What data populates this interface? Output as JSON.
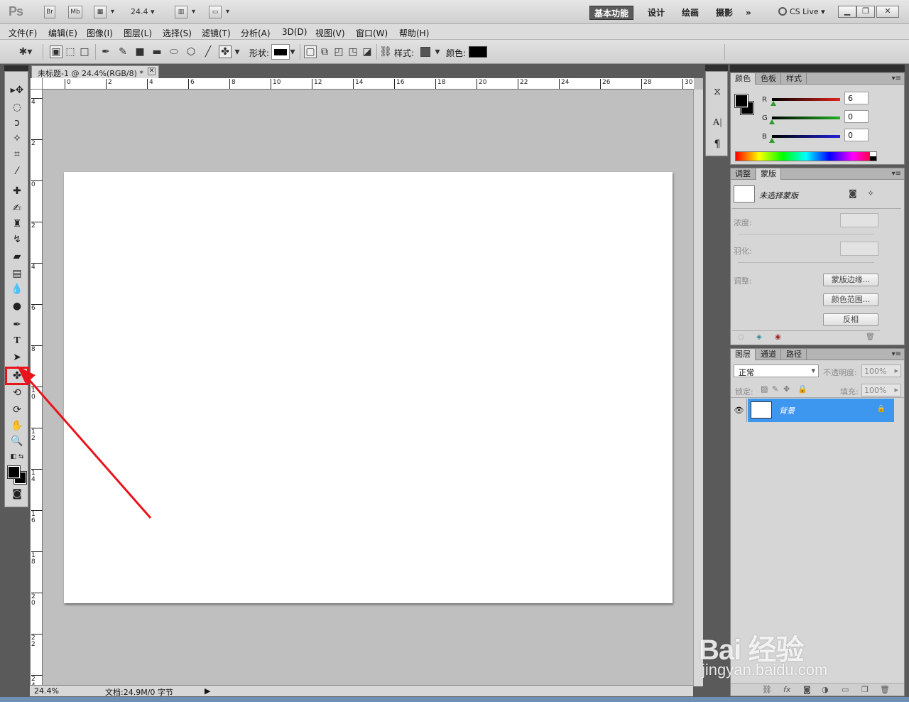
{
  "app": {
    "logo": "Ps",
    "bridge_label": "Br",
    "minibridge_label": "Mb",
    "zoom_value": "24.4",
    "workspaces": [
      "基本功能",
      "设计",
      "绘画",
      "摄影"
    ],
    "more_workspaces": "»",
    "cs_live": "CS Live"
  },
  "menu": [
    "文件(F)",
    "编辑(E)",
    "图像(I)",
    "图层(L)",
    "选择(S)",
    "滤镜(T)",
    "分析(A)",
    "3D(D)",
    "视图(V)",
    "窗口(W)",
    "帮助(H)"
  ],
  "options": {
    "shape_label": "形状:",
    "style_label": "样式:",
    "color_label": "颜色:",
    "color_value": "#000000"
  },
  "document": {
    "tab_title": "未标题-1 @ 24.4%(RGB/8) *",
    "ruler_top": [
      "0",
      "2",
      "4",
      "6",
      "8",
      "10",
      "12",
      "14",
      "16",
      "18",
      "20",
      "22",
      "24",
      "26",
      "28",
      "30"
    ],
    "ruler_left": [
      "4",
      "2",
      "0",
      "2",
      "4",
      "6",
      "8",
      "1 0",
      "1 2",
      "1 4",
      "1 6",
      "1 8",
      "2 0",
      "2 2",
      "2 4"
    ],
    "status_zoom": "24.4%",
    "status_doc": "文档:24.9M/0 字节"
  },
  "color_panel": {
    "tabs": [
      "颜色",
      "色板",
      "样式"
    ],
    "channels": [
      {
        "label": "R",
        "value": "6",
        "color": "#e0231b"
      },
      {
        "label": "G",
        "value": "0",
        "color": "#22b022"
      },
      {
        "label": "B",
        "value": "0",
        "color": "#2222d8"
      }
    ]
  },
  "masks_panel": {
    "tabs": [
      "调整",
      "蒙版"
    ],
    "no_mask": "未选择蒙版",
    "density_label": "浓度:",
    "feather_label": "羽化:",
    "refine_label": "调整:",
    "mask_edge_button": "蒙版边缘...",
    "color_range_button": "颜色范围...",
    "invert_button": "反相"
  },
  "layers_panel": {
    "tabs": [
      "图层",
      "通道",
      "路径"
    ],
    "blend_mode": "正常",
    "opacity_label": "不透明度:",
    "opacity_value": "100%",
    "lock_label": "锁定:",
    "fill_label": "填充:",
    "fill_value": "100%",
    "layer_name": "背景"
  },
  "watermark": {
    "main": "Bai 经验",
    "sub": "jingyan.baidu.com"
  },
  "annotation_color": "#e8141b"
}
